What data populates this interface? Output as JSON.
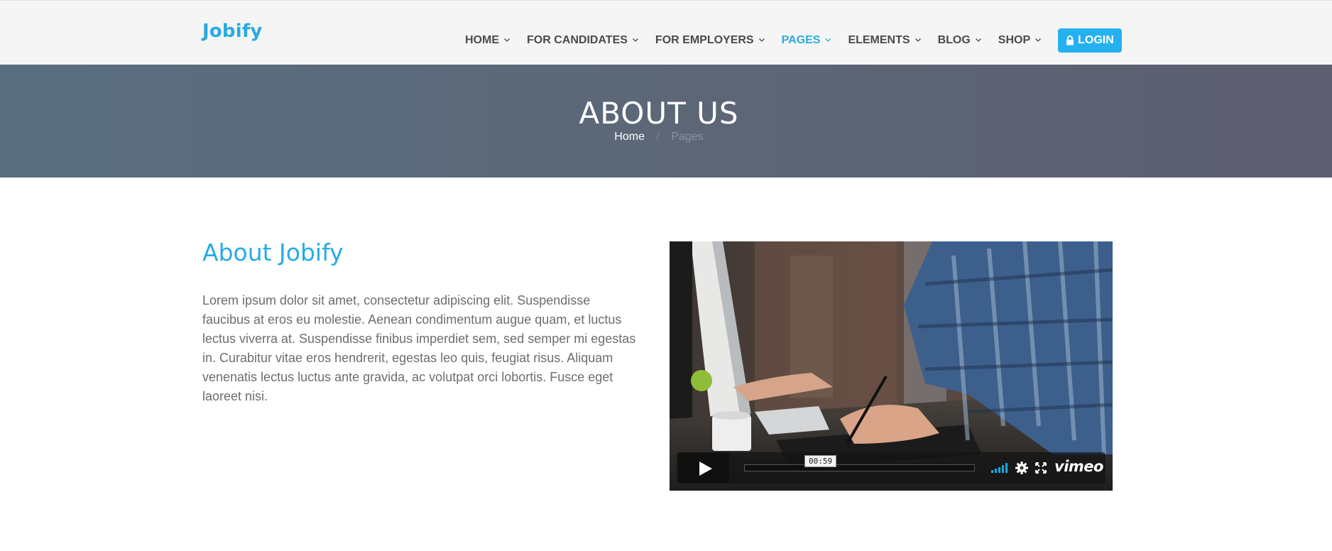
{
  "header": {
    "logo": "Jobify",
    "nav": [
      {
        "label": "HOME"
      },
      {
        "label": "FOR CANDIDATES"
      },
      {
        "label": "FOR EMPLOYERS"
      },
      {
        "label": "PAGES",
        "active": true
      },
      {
        "label": "ELEMENTS"
      },
      {
        "label": "BLOG"
      },
      {
        "label": "SHOP"
      }
    ],
    "login_label": "LOGIN"
  },
  "banner": {
    "title": "ABOUT US",
    "breadcrumb": {
      "home": "Home",
      "separator": "/",
      "current": "Pages"
    }
  },
  "about": {
    "title": "About Jobify",
    "text": "Lorem ipsum dolor sit amet, consectetur adipiscing elit. Suspendisse faucibus at eros eu molestie. Aenean condimentum augue quam, et luctus lectus viverra at. Suspendisse finibus imperdiet sem, sed semper mi egestas in. Curabitur vitae eros hendrerit, egestas leo quis, feugiat risus. Aliquam venenatis lectus luctus ante gravida, ac volutpat orci lobortis. Fusce eget laoreet nisi."
  },
  "video": {
    "time": "00:59",
    "provider": "vimeo"
  },
  "colors": {
    "accent": "#29aae3",
    "login_bg": "#25b1f0",
    "banner_start": "#596e7f",
    "banner_end": "#5d5e70"
  }
}
